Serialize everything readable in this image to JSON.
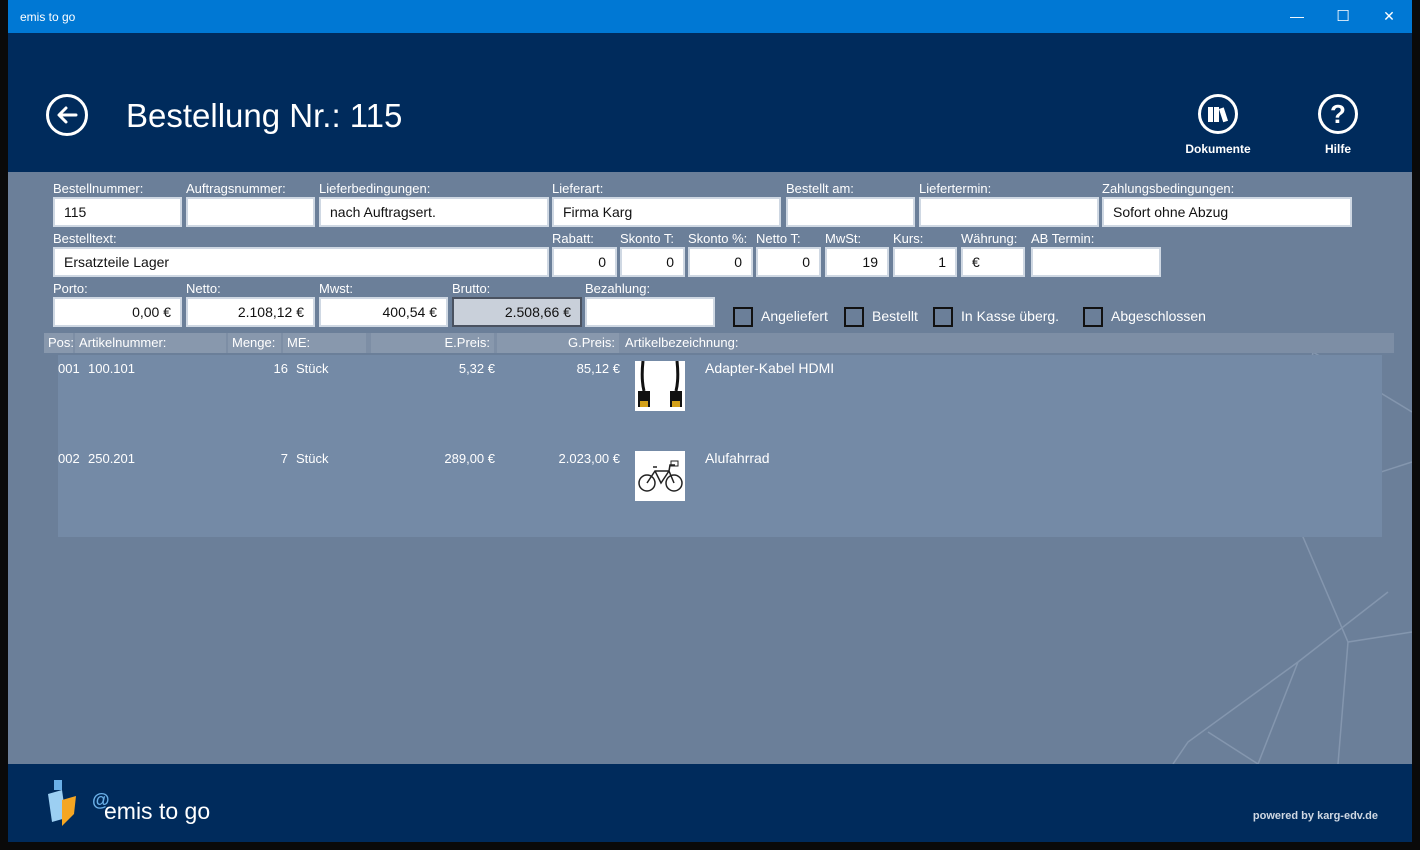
{
  "window": {
    "title": "emis to go",
    "minimize": "—",
    "maximize": "☐",
    "close": "✕"
  },
  "header": {
    "title": "Bestellung Nr.: 115",
    "buttons": [
      {
        "label": "Dokumente"
      },
      {
        "label": "Hilfe"
      }
    ]
  },
  "form": {
    "bestellnummer": {
      "label": "Bestellnummer:",
      "value": "115"
    },
    "auftragsnummer": {
      "label": "Auftragsnummer:",
      "value": ""
    },
    "lieferbedingungen": {
      "label": "Lieferbedingungen:",
      "value": "nach  Auftragsert."
    },
    "lieferart": {
      "label": "Lieferart:",
      "value": "Firma Karg"
    },
    "bestellt_am": {
      "label": "Bestellt am:",
      "value": ""
    },
    "liefertermin": {
      "label": "Liefertermin:",
      "value": ""
    },
    "zahlungsbedingungen": {
      "label": "Zahlungsbedingungen:",
      "value": "Sofort ohne Abzug"
    },
    "bestelltext": {
      "label": "Bestelltext:",
      "value": "Ersatzteile Lager"
    },
    "rabatt": {
      "label": "Rabatt:",
      "value": "0"
    },
    "skonto_t": {
      "label": "Skonto T:",
      "value": "0"
    },
    "skonto_pct": {
      "label": "Skonto %:",
      "value": "0"
    },
    "netto_t": {
      "label": "Netto T:",
      "value": "0"
    },
    "mwst": {
      "label": "MwSt:",
      "value": "19"
    },
    "kurs": {
      "label": "Kurs:",
      "value": "1"
    },
    "waehrung": {
      "label": "Währung:",
      "value": "€"
    },
    "ab_termin": {
      "label": "AB Termin:",
      "value": ""
    },
    "porto": {
      "label": "Porto:",
      "value": "0,00 €"
    },
    "netto": {
      "label": "Netto:",
      "value": "2.108,12 €"
    },
    "mwst_betrag": {
      "label": "Mwst:",
      "value": "400,54 €"
    },
    "brutto": {
      "label": "Brutto:",
      "value": "2.508,66 €"
    },
    "bezahlung": {
      "label": "Bezahlung:",
      "value": ""
    }
  },
  "checkboxes": [
    {
      "label": "Angeliefert",
      "checked": false
    },
    {
      "label": "Bestellt",
      "checked": false
    },
    {
      "label": "In Kasse überg.",
      "checked": false
    },
    {
      "label": "Abgeschlossen",
      "checked": false
    }
  ],
  "table": {
    "columns": [
      "Pos:",
      "Artikelnummer:",
      "Menge:",
      "ME:",
      "E.Preis:",
      "G.Preis:",
      "Artikelbezeichnung:"
    ],
    "rows": [
      {
        "pos": "001",
        "artikelnummer": "100.101",
        "menge": "16",
        "me": "Stück",
        "epreis": "5,32 €",
        "gpreis": "85,12 €",
        "icon": "hdmi-cable-image",
        "bezeichnung": "Adapter-Kabel HDMI"
      },
      {
        "pos": "002",
        "artikelnummer": "250.201",
        "menge": "7",
        "me": "Stück",
        "epreis": "289,00 €",
        "gpreis": "2.023,00 €",
        "icon": "bicycle-image",
        "bezeichnung": "Alufahrrad"
      }
    ]
  },
  "footer": {
    "brand": "emis to go",
    "brand_mark": "@",
    "powered": "powered by karg-edv.de"
  },
  "colors": {
    "titlebar": "#0078d4",
    "header": "#002b5c",
    "content": "#6b7f99"
  }
}
